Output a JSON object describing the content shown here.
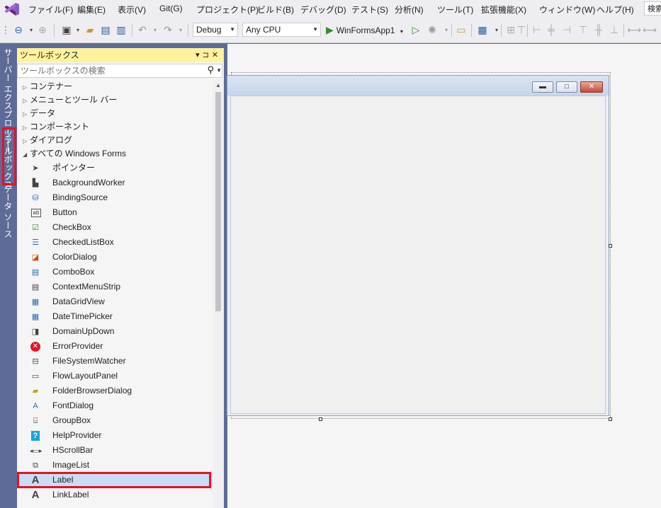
{
  "menu": [
    "ファイル(F)",
    "編集(E)",
    "表示(V)",
    "Git(G)",
    "プロジェクト(P)",
    "ビルド(B)",
    "デバッグ(D)",
    "テスト(S)",
    "分析(N)",
    "ツール(T)",
    "拡張機能(X)",
    "ウィンドウ(W)",
    "ヘルプ(H)"
  ],
  "search_label": "検索",
  "toolbar": {
    "config": "Debug",
    "platform": "Any CPU",
    "run_target": "WinFormsApp1"
  },
  "side_tabs": [
    "サーバー エクスプローラー",
    "ツールボックス",
    "データ ソース"
  ],
  "toolbox": {
    "title": "ツールボックス",
    "search_placeholder": "ツールボックスの検索",
    "categories": [
      "コンテナー",
      "メニューとツール バー",
      "データ",
      "コンポーネント",
      "ダイアログ"
    ],
    "expanded_category": "すべての Windows Forms",
    "items": [
      {
        "label": "ポインター",
        "icon": "pointer-icon"
      },
      {
        "label": "BackgroundWorker",
        "icon": "backgroundworker-icon"
      },
      {
        "label": "BindingSource",
        "icon": "bindingsource-icon"
      },
      {
        "label": "Button",
        "icon": "button-icon"
      },
      {
        "label": "CheckBox",
        "icon": "checkbox-icon"
      },
      {
        "label": "CheckedListBox",
        "icon": "checkedlistbox-icon"
      },
      {
        "label": "ColorDialog",
        "icon": "colordialog-icon"
      },
      {
        "label": "ComboBox",
        "icon": "combobox-icon"
      },
      {
        "label": "ContextMenuStrip",
        "icon": "contextmenustrip-icon"
      },
      {
        "label": "DataGridView",
        "icon": "datagridview-icon"
      },
      {
        "label": "DateTimePicker",
        "icon": "datetimepicker-icon"
      },
      {
        "label": "DomainUpDown",
        "icon": "domainupdown-icon"
      },
      {
        "label": "ErrorProvider",
        "icon": "errorprovider-icon"
      },
      {
        "label": "FileSystemWatcher",
        "icon": "filesystemwatcher-icon"
      },
      {
        "label": "FlowLayoutPanel",
        "icon": "flowlayoutpanel-icon"
      },
      {
        "label": "FolderBrowserDialog",
        "icon": "folderbrowserdialog-icon"
      },
      {
        "label": "FontDialog",
        "icon": "fontdialog-icon"
      },
      {
        "label": "GroupBox",
        "icon": "groupbox-icon"
      },
      {
        "label": "HelpProvider",
        "icon": "helpprovider-icon"
      },
      {
        "label": "HScrollBar",
        "icon": "hscrollbar-icon"
      },
      {
        "label": "ImageList",
        "icon": "imagelist-icon"
      },
      {
        "label": "Label",
        "icon": "label-icon",
        "selected": true
      },
      {
        "label": "LinkLabel",
        "icon": "linklabel-icon"
      }
    ]
  },
  "colors": {
    "chrome": "#eeeef2",
    "rail": "#5d6b99",
    "title_active": "#fff29d",
    "selected": "#c9def5",
    "highlight_box": "#e81123"
  }
}
